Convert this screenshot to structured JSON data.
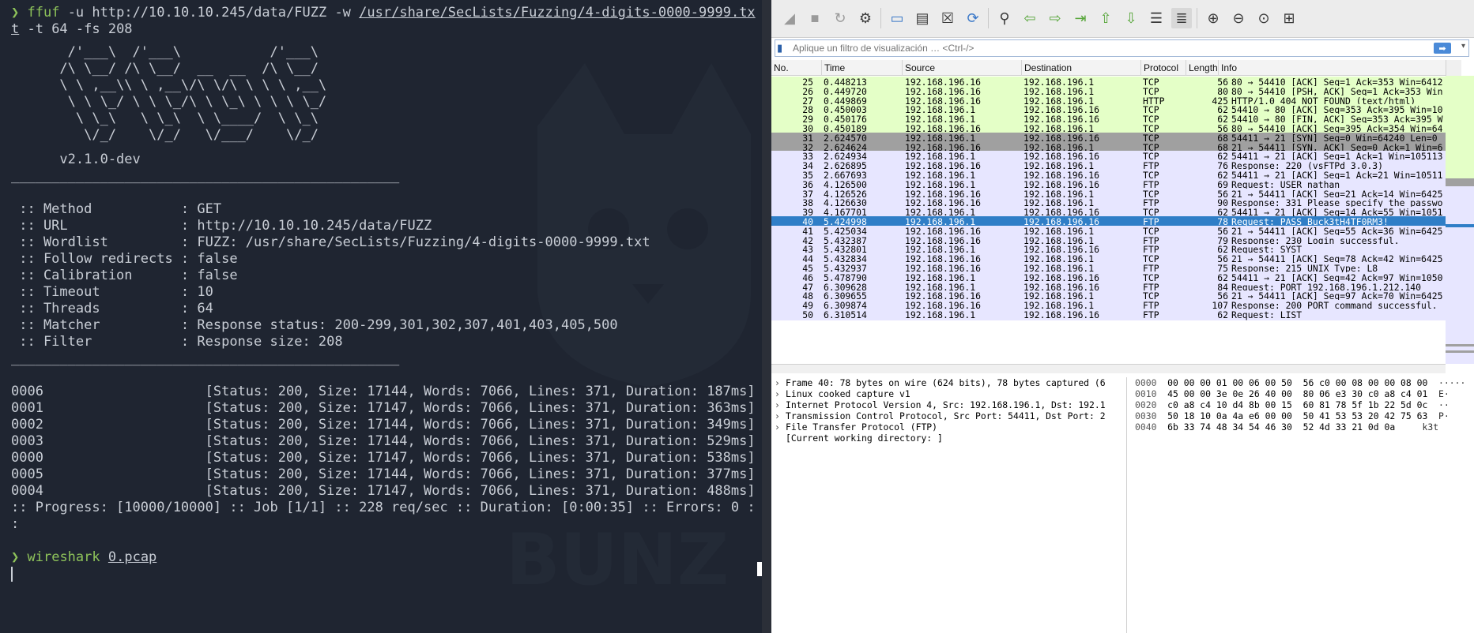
{
  "terminal": {
    "line1_prompt": "❯",
    "line1_cmd": "ffuf",
    "line1_args": " -u http://10.10.10.245/data/FUZZ -w ",
    "line1_wordlist_a": "/usr/share/SecLists/Fuzzing/4-digits-0000-9999.tx",
    "line2_wordlist_b": "t",
    "line2_rest": " -t 64 -fs 208",
    "banner": "       /'___\\  /'___\\           /'___\\       \n      /\\ \\__/ /\\ \\__/  __  __  /\\ \\__/       \n      \\ \\ ,__\\\\ \\ ,__\\/\\ \\/\\ \\ \\ \\ ,__\\      \n       \\ \\ \\_/ \\ \\ \\_/\\ \\ \\_\\ \\ \\ \\ \\_/      \n        \\ \\_\\   \\ \\_\\  \\ \\____/  \\ \\_\\       \n         \\/_/    \\/_/   \\/___/    \\/_/       ",
    "version": "      v2.1.0-dev",
    "separator": "________________________________________________",
    "config": [
      " :: Method           : GET",
      " :: URL              : http://10.10.10.245/data/FUZZ",
      " :: Wordlist         : FUZZ: /usr/share/SecLists/Fuzzing/4-digits-0000-9999.txt",
      " :: Follow redirects : false",
      " :: Calibration      : false",
      " :: Timeout          : 10",
      " :: Threads          : 64",
      " :: Matcher          : Response status: 200-299,301,302,307,401,403,405,500",
      " :: Filter           : Response size: 208"
    ],
    "results": [
      "0006                    [Status: 200, Size: 17144, Words: 7066, Lines: 371, Duration: 187ms]",
      "0001                    [Status: 200, Size: 17147, Words: 7066, Lines: 371, Duration: 363ms]",
      "0002                    [Status: 200, Size: 17144, Words: 7066, Lines: 371, Duration: 349ms]",
      "0003                    [Status: 200, Size: 17144, Words: 7066, Lines: 371, Duration: 529ms]",
      "0000                    [Status: 200, Size: 17147, Words: 7066, Lines: 371, Duration: 538ms]",
      "0005                    [Status: 200, Size: 17144, Words: 7066, Lines: 371, Duration: 377ms]",
      "0004                    [Status: 200, Size: 17147, Words: 7066, Lines: 371, Duration: 488ms]"
    ],
    "progress": ":: Progress: [10000/10000] :: Job [1/1] :: 228 req/sec :: Duration: [0:00:35] :: Errors: 0 :",
    "progress_tail": ":",
    "last_prompt": "❯",
    "last_cmd": "wireshark",
    "last_arg": "0.pcap",
    "watermark_text": "BUNZ"
  },
  "wireshark": {
    "filter_placeholder": "Aplique un filtro de visualización … <Ctrl-/>",
    "apply_icon": "arrow-right-icon",
    "columns": [
      "No.",
      "Time",
      "Source",
      "Destination",
      "Protocol",
      "Length",
      "Info"
    ],
    "colors": {
      "tcp": "#e7e6ff",
      "http": "#e4ffc7",
      "syn": "#a0a0a0",
      "ftp": "#e7e6ff",
      "selected": "#2f7ec7"
    },
    "packets": [
      {
        "no": "25",
        "time": "0.448213",
        "src": "192.168.196.16",
        "dst": "192.168.196.1",
        "proto": "TCP",
        "len": "56",
        "info": "80 → 54410 [ACK] Seq=1 Ack=353 Win=6412",
        "kind": "http"
      },
      {
        "no": "26",
        "time": "0.449720",
        "src": "192.168.196.16",
        "dst": "192.168.196.1",
        "proto": "TCP",
        "len": "80",
        "info": "80 → 54410 [PSH, ACK] Seq=1 Ack=353 Win",
        "kind": "http"
      },
      {
        "no": "27",
        "time": "0.449869",
        "src": "192.168.196.16",
        "dst": "192.168.196.1",
        "proto": "HTTP",
        "len": "425",
        "info": "HTTP/1.0 404 NOT FOUND  (text/html)",
        "kind": "http"
      },
      {
        "no": "28",
        "time": "0.450003",
        "src": "192.168.196.1",
        "dst": "192.168.196.16",
        "proto": "TCP",
        "len": "62",
        "info": "54410 → 80 [ACK] Seq=353 Ack=395 Win=10",
        "kind": "http"
      },
      {
        "no": "29",
        "time": "0.450176",
        "src": "192.168.196.1",
        "dst": "192.168.196.16",
        "proto": "TCP",
        "len": "62",
        "info": "54410 → 80 [FIN, ACK] Seq=353 Ack=395 W",
        "kind": "http"
      },
      {
        "no": "30",
        "time": "0.450189",
        "src": "192.168.196.16",
        "dst": "192.168.196.1",
        "proto": "TCP",
        "len": "56",
        "info": "80 → 54410 [ACK] Seq=395 Ack=354 Win=64",
        "kind": "http"
      },
      {
        "no": "31",
        "time": "2.624570",
        "src": "192.168.196.1",
        "dst": "192.168.196.16",
        "proto": "TCP",
        "len": "68",
        "info": "54411 → 21 [SYN] Seq=0 Win=64240 Len=0",
        "kind": "syn"
      },
      {
        "no": "32",
        "time": "2.624624",
        "src": "192.168.196.16",
        "dst": "192.168.196.1",
        "proto": "TCP",
        "len": "68",
        "info": "21 → 54411 [SYN, ACK] Seq=0 Ack=1 Win=6",
        "kind": "syn"
      },
      {
        "no": "33",
        "time": "2.624934",
        "src": "192.168.196.1",
        "dst": "192.168.196.16",
        "proto": "TCP",
        "len": "62",
        "info": "54411 → 21 [ACK] Seq=1 Ack=1 Win=105113",
        "kind": "tcp"
      },
      {
        "no": "34",
        "time": "2.626895",
        "src": "192.168.196.16",
        "dst": "192.168.196.1",
        "proto": "FTP",
        "len": "76",
        "info": "Response: 220 (vsFTPd 3.0.3)",
        "kind": "ftp"
      },
      {
        "no": "35",
        "time": "2.667693",
        "src": "192.168.196.1",
        "dst": "192.168.196.16",
        "proto": "TCP",
        "len": "62",
        "info": "54411 → 21 [ACK] Seq=1 Ack=21 Win=10511",
        "kind": "tcp"
      },
      {
        "no": "36",
        "time": "4.126500",
        "src": "192.168.196.1",
        "dst": "192.168.196.16",
        "proto": "FTP",
        "len": "69",
        "info": "Request: USER nathan",
        "kind": "ftp"
      },
      {
        "no": "37",
        "time": "4.126526",
        "src": "192.168.196.16",
        "dst": "192.168.196.1",
        "proto": "TCP",
        "len": "56",
        "info": "21 → 54411 [ACK] Seq=21 Ack=14 Win=6425",
        "kind": "tcp"
      },
      {
        "no": "38",
        "time": "4.126630",
        "src": "192.168.196.16",
        "dst": "192.168.196.1",
        "proto": "FTP",
        "len": "90",
        "info": "Response: 331 Please specify the passwo",
        "kind": "ftp"
      },
      {
        "no": "39",
        "time": "4.167701",
        "src": "192.168.196.1",
        "dst": "192.168.196.16",
        "proto": "TCP",
        "len": "62",
        "info": "54411 → 21 [ACK] Seq=14 Ack=55 Win=1051",
        "kind": "tcp"
      },
      {
        "no": "40",
        "time": "5.424998",
        "src": "192.168.196.1",
        "dst": "192.168.196.16",
        "proto": "FTP",
        "len": "78",
        "info": "Request: PASS Buck3tH4TF0RM3!",
        "kind": "selected"
      },
      {
        "no": "41",
        "time": "5.425034",
        "src": "192.168.196.16",
        "dst": "192.168.196.1",
        "proto": "TCP",
        "len": "56",
        "info": "21 → 54411 [ACK] Seq=55 Ack=36 Win=6425",
        "kind": "tcp"
      },
      {
        "no": "42",
        "time": "5.432387",
        "src": "192.168.196.16",
        "dst": "192.168.196.1",
        "proto": "FTP",
        "len": "79",
        "info": "Response: 230 Login successful.",
        "kind": "ftp"
      },
      {
        "no": "43",
        "time": "5.432801",
        "src": "192.168.196.1",
        "dst": "192.168.196.16",
        "proto": "FTP",
        "len": "62",
        "info": "Request: SYST",
        "kind": "ftp"
      },
      {
        "no": "44",
        "time": "5.432834",
        "src": "192.168.196.16",
        "dst": "192.168.196.1",
        "proto": "TCP",
        "len": "56",
        "info": "21 → 54411 [ACK] Seq=78 Ack=42 Win=6425",
        "kind": "tcp"
      },
      {
        "no": "45",
        "time": "5.432937",
        "src": "192.168.196.16",
        "dst": "192.168.196.1",
        "proto": "FTP",
        "len": "75",
        "info": "Response: 215 UNIX Type: L8",
        "kind": "ftp"
      },
      {
        "no": "46",
        "time": "5.478790",
        "src": "192.168.196.1",
        "dst": "192.168.196.16",
        "proto": "TCP",
        "len": "62",
        "info": "54411 → 21 [ACK] Seq=42 Ack=97 Win=1050",
        "kind": "tcp"
      },
      {
        "no": "47",
        "time": "6.309628",
        "src": "192.168.196.1",
        "dst": "192.168.196.16",
        "proto": "FTP",
        "len": "84",
        "info": "Request: PORT 192,168,196,1,212,140",
        "kind": "ftp"
      },
      {
        "no": "48",
        "time": "6.309655",
        "src": "192.168.196.16",
        "dst": "192.168.196.1",
        "proto": "TCP",
        "len": "56",
        "info": "21 → 54411 [ACK] Seq=97 Ack=70 Win=6425",
        "kind": "tcp"
      },
      {
        "no": "49",
        "time": "6.309874",
        "src": "192.168.196.16",
        "dst": "192.168.196.1",
        "proto": "FTP",
        "len": "107",
        "info": "Response: 200 PORT command successful.",
        "kind": "ftp"
      },
      {
        "no": "50",
        "time": "6.310514",
        "src": "192.168.196.1",
        "dst": "192.168.196.16",
        "proto": "FTP",
        "len": "62",
        "info": "Request: LIST",
        "kind": "ftp"
      }
    ],
    "details": [
      {
        "arrow": "›",
        "text": "Frame 40: 78 bytes on wire (624 bits), 78 bytes captured (6"
      },
      {
        "arrow": "›",
        "text": "Linux cooked capture v1"
      },
      {
        "arrow": "›",
        "text": "Internet Protocol Version 4, Src: 192.168.196.1, Dst: 192.1"
      },
      {
        "arrow": "›",
        "text": "Transmission Control Protocol, Src Port: 54411, Dst Port: 2"
      },
      {
        "arrow": "›",
        "text": "File Transfer Protocol (FTP)"
      },
      {
        "arrow": "",
        "text": "[Current working directory: ]"
      }
    ],
    "bytes": [
      {
        "off": "0000",
        "hex": "00 00 00 01 00 06 00 50  56 c0 00 08 00 00 08 00",
        "asc": "  ·····"
      },
      {
        "off": "0010",
        "hex": "45 00 00 3e 0e 26 40 00  80 06 e3 30 c0 a8 c4 01",
        "asc": "  E·"
      },
      {
        "off": "0020",
        "hex": "c0 a8 c4 10 d4 8b 00 15  60 81 78 5f 1b 22 5d 0c",
        "asc": "  ··"
      },
      {
        "off": "0030",
        "hex": "50 18 10 0a 4a e6 00 00  50 41 53 53 20 42 75 63",
        "asc": "  P·"
      },
      {
        "off": "0040",
        "hex": "6b 33 74 48 34 54 46 30  52 4d 33 21 0d 0a",
        "asc": "     k3t"
      }
    ]
  }
}
